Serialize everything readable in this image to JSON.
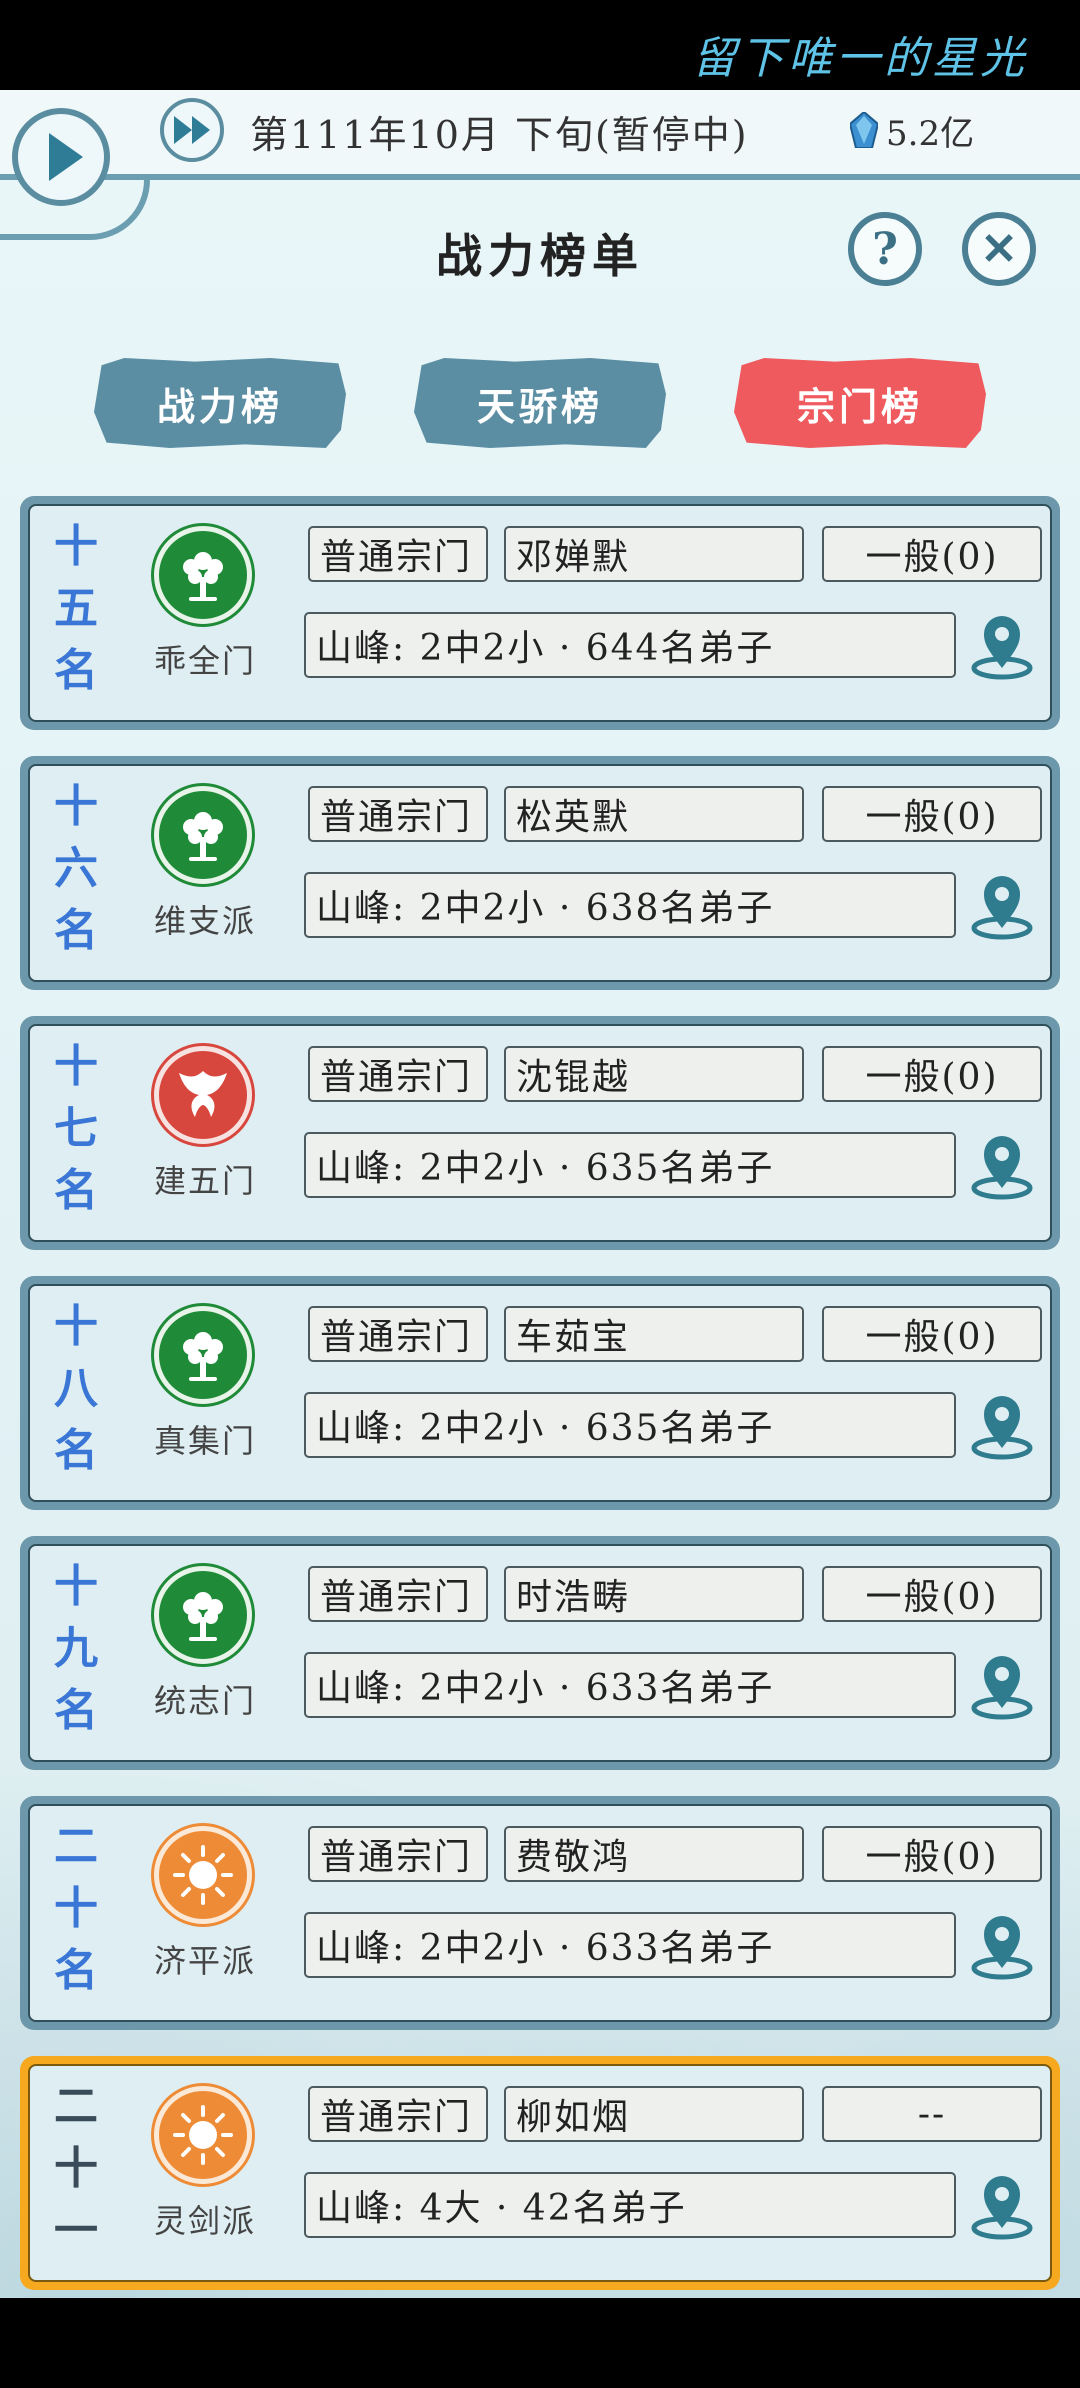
{
  "top_title": "留下唯一的星光",
  "status": {
    "date": "第111年10月 下旬(暂停中)",
    "currency": "5.2亿"
  },
  "header": {
    "title": "战力榜单",
    "help_label": "?",
    "close_label": "✕"
  },
  "tabs": [
    {
      "label": "战力榜",
      "active": false
    },
    {
      "label": "天骄榜",
      "active": false
    },
    {
      "label": "宗门榜",
      "active": true
    }
  ],
  "colors": {
    "accent": "#6d97aa",
    "active_tab": "#ef5a5f",
    "rank_text": "#3a76d6",
    "highlight": "#f6a91f"
  },
  "rankings": [
    {
      "rank": "十五名",
      "emblem": "tree-emblem",
      "sect": "乖全门",
      "type": "普通宗门",
      "leader": "邓婵默",
      "relation": "一般(0)",
      "peak": "山峰: 2中2小 · 644名弟子"
    },
    {
      "rank": "十六名",
      "emblem": "tree-emblem",
      "sect": "维支派",
      "type": "普通宗门",
      "leader": "松英默",
      "relation": "一般(0)",
      "peak": "山峰: 2中2小 · 638名弟子"
    },
    {
      "rank": "十七名",
      "emblem": "phoenix-emblem",
      "sect": "建五门",
      "type": "普通宗门",
      "leader": "沈锟越",
      "relation": "一般(0)",
      "peak": "山峰: 2中2小 · 635名弟子"
    },
    {
      "rank": "十八名",
      "emblem": "tree-emblem",
      "sect": "真集门",
      "type": "普通宗门",
      "leader": "车茹宝",
      "relation": "一般(0)",
      "peak": "山峰: 2中2小 · 635名弟子"
    },
    {
      "rank": "十九名",
      "emblem": "tree-emblem",
      "sect": "统志门",
      "type": "普通宗门",
      "leader": "时浩畴",
      "relation": "一般(0)",
      "peak": "山峰: 2中2小 · 633名弟子"
    },
    {
      "rank": "二十名",
      "emblem": "sun-emblem",
      "sect": "济平派",
      "type": "普通宗门",
      "leader": "费敬鸿",
      "relation": "一般(0)",
      "peak": "山峰: 2中2小 · 633名弟子"
    },
    {
      "rank": "二十一",
      "emblem": "sun-emblem",
      "sect": "灵剑派",
      "type": "普通宗门",
      "leader": "柳如烟",
      "relation": "--",
      "peak": "山峰: 4大 · 42名弟子",
      "highlight": true
    }
  ]
}
